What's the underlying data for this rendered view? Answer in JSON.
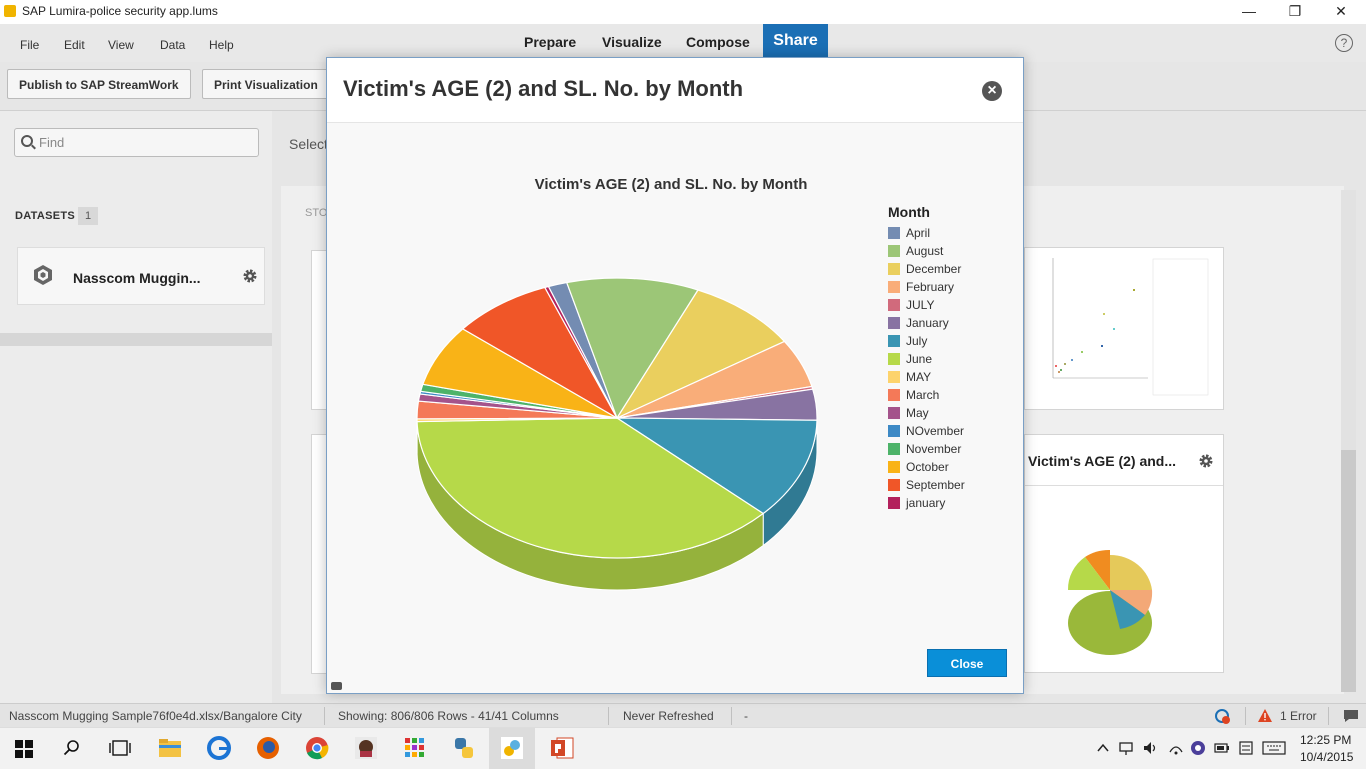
{
  "window": {
    "title": "SAP Lumira-police security app.lums",
    "minimize": "—",
    "maximize": "❐",
    "close": "✕"
  },
  "menu": {
    "items": [
      "File",
      "Edit",
      "View",
      "Data",
      "Help"
    ],
    "tabs": [
      "Prepare",
      "Visualize",
      "Compose",
      "Share"
    ],
    "help": "?"
  },
  "toolbar": {
    "publish_label": "Publish to SAP StreamWork",
    "print_label": "Print Visualization"
  },
  "sidebar": {
    "search_placeholder": "Find",
    "datasets_label": "DATASETS",
    "datasets_count": "1",
    "dataset_name": "Nasscom Muggin..."
  },
  "main": {
    "select_text": "Select",
    "storyboard_label": "STO",
    "card_title": "Victim's AGE (2) and..."
  },
  "dialog": {
    "title": "Victim's AGE (2) and SL. No. by Month",
    "close_label": "Close"
  },
  "chart_data": {
    "type": "pie",
    "title": "Victim's AGE (2) and SL. No. by Month",
    "legend_title": "Month",
    "legend_position": "right",
    "categories": [
      "April",
      "August",
      "December",
      "February",
      "JULY",
      "January",
      "July",
      "June",
      "MAY",
      "March",
      "May",
      "NOvember",
      "November",
      "October",
      "September",
      "january"
    ],
    "colors": [
      "#748cb2",
      "#9cc677",
      "#eacf5e",
      "#f9ad79",
      "#d16a7c",
      "#8873a2",
      "#3a95b3",
      "#b6d949",
      "#fdd36c",
      "#f47958",
      "#a4538b",
      "#3d89c5",
      "#4db369",
      "#f9b317",
      "#f05628",
      "#b3215c"
    ],
    "values": [
      1.5,
      10.5,
      9.0,
      5.5,
      0.3,
      3.5,
      11.5,
      37.0,
      0.3,
      2.0,
      0.8,
      0.3,
      0.8,
      7.0,
      8.0,
      0.3
    ]
  },
  "status": {
    "dataset": "Nasscom Mugging Sample76f0e4d.xlsx/Bangalore City",
    "showing": "Showing: 806/806 Rows - 41/41 Columns",
    "refreshed": "Never Refreshed",
    "dash": "-",
    "errors": "1 Error"
  },
  "taskbar": {
    "time": "12:25 PM",
    "date": "10/4/2015"
  }
}
